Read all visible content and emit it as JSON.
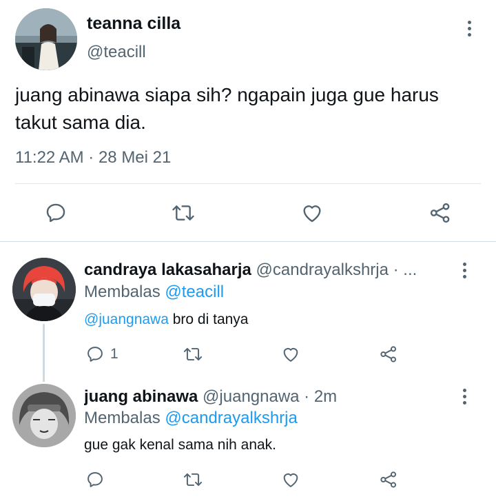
{
  "main_tweet": {
    "name": "teanna cilla",
    "handle": "@teacill",
    "text": "juang abinawa siapa sih? ngapain juga gue harus takut sama dia.",
    "time": "11:22 AM · 28 Mei 21",
    "actions": [
      "reply-icon",
      "retweet-icon",
      "like-icon",
      "share-icon"
    ]
  },
  "replies": [
    {
      "name": "candraya lakasaharja",
      "handle": "@candrayalkshrja · ...",
      "replying_prefix": "Membalas",
      "replying_to": "@teacill",
      "mention": "@juangnawa",
      "text": " bro di tanya",
      "reply_count": "1"
    },
    {
      "name": "juang abinawa",
      "handle": "@juangnawa · 2m",
      "replying_prefix": "Membalas",
      "replying_to": "@candrayalkshrja",
      "text": "gue gak kenal sama nih anak."
    }
  ],
  "colors": {
    "text": "#0f1419",
    "secondary": "#536471",
    "link": "#1d9bf0",
    "divider": "#e1e6ea"
  }
}
